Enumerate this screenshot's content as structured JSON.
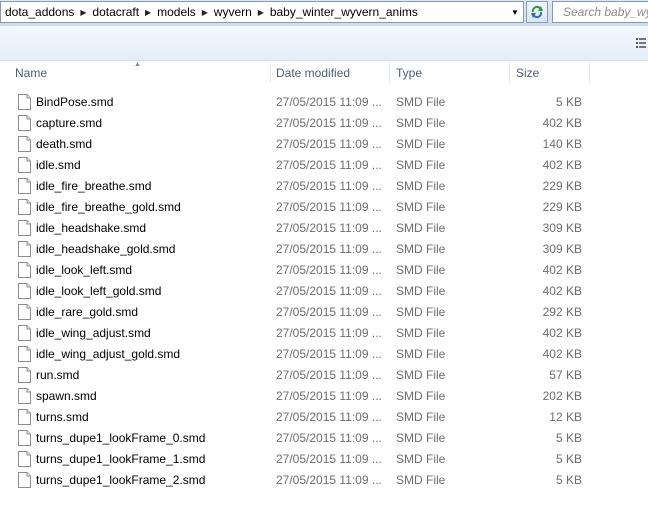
{
  "address": {
    "crumbs": [
      "dota_addons",
      "dotacraft",
      "models",
      "wyvern",
      "baby_winter_wyvern_anims"
    ]
  },
  "search": {
    "placeholder": "Search baby_wyvern_anims"
  },
  "columns": {
    "name": "Name",
    "date": "Date modified",
    "type": "Type",
    "size": "Size"
  },
  "files": [
    {
      "name": "BindPose.smd",
      "date": "27/05/2015 11:09 ...",
      "type": "SMD File",
      "size": "5 KB"
    },
    {
      "name": "capture.smd",
      "date": "27/05/2015 11:09 ...",
      "type": "SMD File",
      "size": "402 KB"
    },
    {
      "name": "death.smd",
      "date": "27/05/2015 11:09 ...",
      "type": "SMD File",
      "size": "140 KB"
    },
    {
      "name": "idle.smd",
      "date": "27/05/2015 11:09 ...",
      "type": "SMD File",
      "size": "402 KB"
    },
    {
      "name": "idle_fire_breathe.smd",
      "date": "27/05/2015 11:09 ...",
      "type": "SMD File",
      "size": "229 KB"
    },
    {
      "name": "idle_fire_breathe_gold.smd",
      "date": "27/05/2015 11:09 ...",
      "type": "SMD File",
      "size": "229 KB"
    },
    {
      "name": "idle_headshake.smd",
      "date": "27/05/2015 11:09 ...",
      "type": "SMD File",
      "size": "309 KB"
    },
    {
      "name": "idle_headshake_gold.smd",
      "date": "27/05/2015 11:09 ...",
      "type": "SMD File",
      "size": "309 KB"
    },
    {
      "name": "idle_look_left.smd",
      "date": "27/05/2015 11:09 ...",
      "type": "SMD File",
      "size": "402 KB"
    },
    {
      "name": "idle_look_left_gold.smd",
      "date": "27/05/2015 11:09 ...",
      "type": "SMD File",
      "size": "402 KB"
    },
    {
      "name": "idle_rare_gold.smd",
      "date": "27/05/2015 11:09 ...",
      "type": "SMD File",
      "size": "292 KB"
    },
    {
      "name": "idle_wing_adjust.smd",
      "date": "27/05/2015 11:09 ...",
      "type": "SMD File",
      "size": "402 KB"
    },
    {
      "name": "idle_wing_adjust_gold.smd",
      "date": "27/05/2015 11:09 ...",
      "type": "SMD File",
      "size": "402 KB"
    },
    {
      "name": "run.smd",
      "date": "27/05/2015 11:09 ...",
      "type": "SMD File",
      "size": "57 KB"
    },
    {
      "name": "spawn.smd",
      "date": "27/05/2015 11:09 ...",
      "type": "SMD File",
      "size": "202 KB"
    },
    {
      "name": "turns.smd",
      "date": "27/05/2015 11:09 ...",
      "type": "SMD File",
      "size": "12 KB"
    },
    {
      "name": "turns_dupe1_lookFrame_0.smd",
      "date": "27/05/2015 11:09 ...",
      "type": "SMD File",
      "size": "5 KB"
    },
    {
      "name": "turns_dupe1_lookFrame_1.smd",
      "date": "27/05/2015 11:09 ...",
      "type": "SMD File",
      "size": "5 KB"
    },
    {
      "name": "turns_dupe1_lookFrame_2.smd",
      "date": "27/05/2015 11:09 ...",
      "type": "SMD File",
      "size": "5 KB"
    }
  ],
  "icons": {
    "file": "document-icon",
    "refresh": "refresh-icon",
    "dropdown": "chevron-down-icon",
    "separator": "chevron-right-icon",
    "view": "view-options-icon",
    "sort": "sort-ascending-icon"
  },
  "colors": {
    "header_text": "#4c607a",
    "meta_text": "#6d6d6d",
    "toolbar_bg": "#e3ecf7",
    "refresh_green": "#2e9a3a",
    "refresh_blue": "#2e6bbd"
  }
}
